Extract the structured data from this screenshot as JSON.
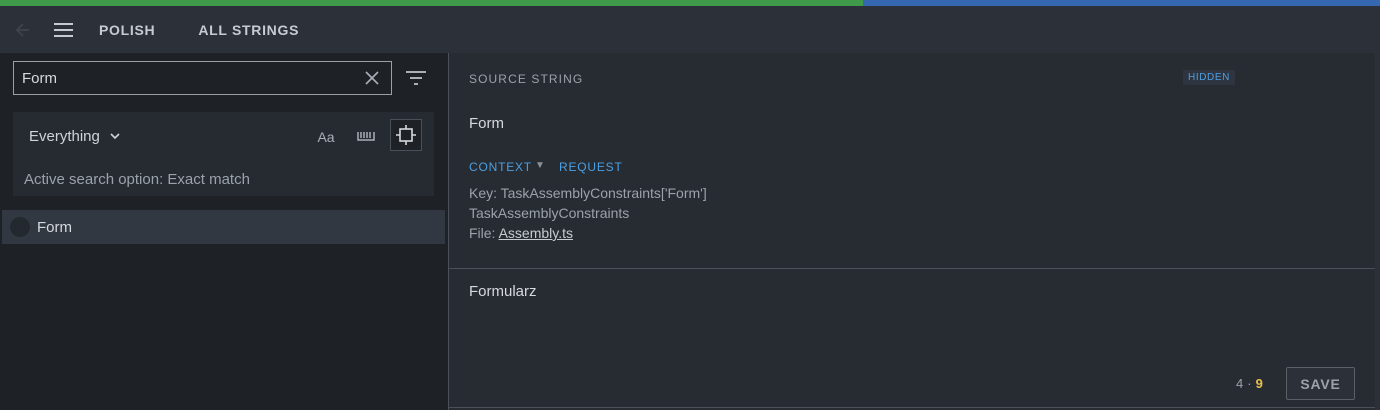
{
  "progress": {
    "fraction": 0.625,
    "colors": {
      "done": "#3f9a4a",
      "remaining": "#3568b0"
    }
  },
  "header": {
    "locale": "POLISH",
    "resource": "ALL STRINGS"
  },
  "search": {
    "value": "Form",
    "placeholder": ""
  },
  "search_options": {
    "selected": "Everything",
    "case_label": "Aa",
    "status": "Active search option: Exact match"
  },
  "entities": [
    {
      "text": "Form"
    }
  ],
  "editor": {
    "section_title": "SOURCE STRING",
    "badge": "HIDDEN",
    "original": "Form",
    "tabs": {
      "context": "CONTEXT",
      "request": "REQUEST"
    },
    "key": "Key: TaskAssemblyConstraints['Form']",
    "comment": "TaskAssemblyConstraints",
    "file_prefix": "File: ",
    "file_name": "Assembly.ts",
    "translation": "Formularz",
    "counter": {
      "current": "4",
      "sep": "·",
      "max": "9"
    },
    "save_label": "SAVE"
  },
  "colors": {
    "accent": "#4d9fe2",
    "warning": "#e8c34a"
  },
  "icons": [
    "back-arrow-icon",
    "menu-icon",
    "close-icon",
    "filter-icon",
    "chevron-down-icon",
    "whitespace-icon",
    "exact-match-icon"
  ]
}
